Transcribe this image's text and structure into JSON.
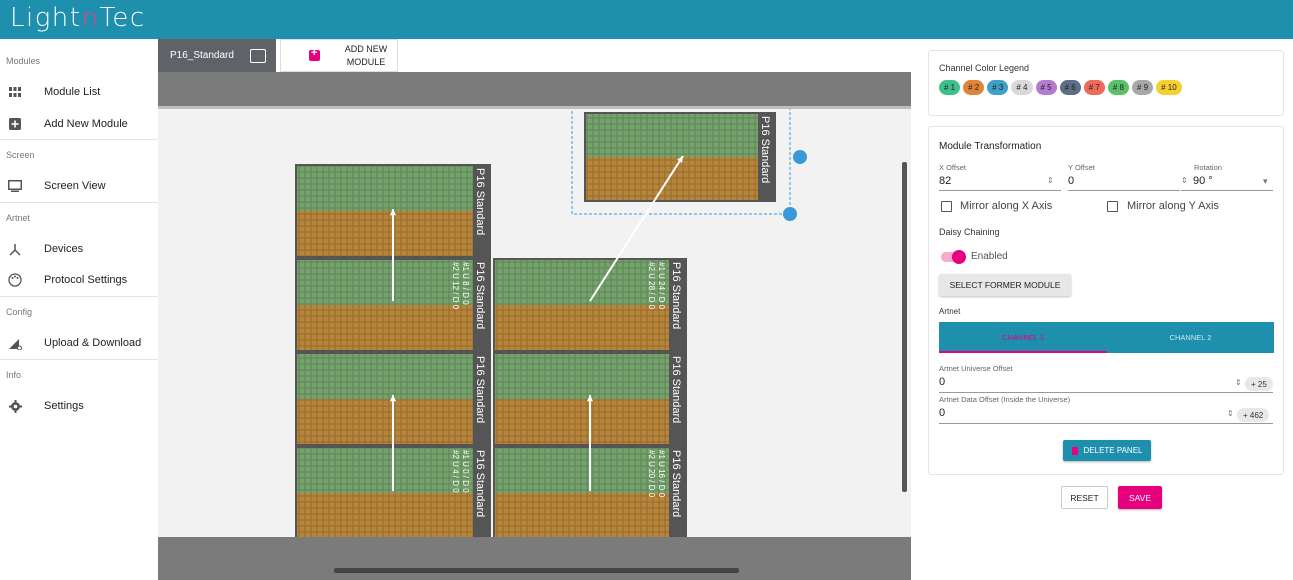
{
  "app": {
    "logo_pre": "Light",
    "logo_mark": "n",
    "logo_post": "Tec"
  },
  "sidebar": {
    "sections": [
      {
        "label": "Modules",
        "items": [
          {
            "label": "Module List",
            "icon": "grid-icon"
          },
          {
            "label": "Add New Module",
            "icon": "add-box-icon"
          }
        ]
      },
      {
        "label": "Screen",
        "items": [
          {
            "label": "Screen View",
            "icon": "monitor-icon"
          }
        ]
      },
      {
        "label": "Artnet",
        "items": [
          {
            "label": "Devices",
            "icon": "network-icon"
          },
          {
            "label": "Protocol Settings",
            "icon": "palette-icon"
          }
        ]
      },
      {
        "label": "Config",
        "items": [
          {
            "label": "Upload & Download",
            "icon": "signal-icon"
          }
        ]
      },
      {
        "label": "Info",
        "items": [
          {
            "label": "Settings",
            "icon": "gear-icon"
          }
        ]
      }
    ]
  },
  "tabs": {
    "active_label": "P16_Standard",
    "add_label": "ADD NEW MODULE"
  },
  "canvas": {
    "panel_name": "P16 Standard",
    "panels": [
      {
        "id": "p1",
        "label": "P16 Standard",
        "info": ""
      },
      {
        "id": "p2",
        "label": "P16 Standard",
        "info": "#1 U 8 / D 0\n#2 U 12 / D 0"
      },
      {
        "id": "p3",
        "label": "P16 Standard",
        "info": ""
      },
      {
        "id": "p4",
        "label": "P16 Standard",
        "info": "#1 U 0 / D 0\n#2 U 4 / D 0"
      },
      {
        "id": "p5",
        "label": "P16 Standard",
        "info": "#1 U 24 / D 0\n#2 U 28 / D 0"
      },
      {
        "id": "p6",
        "label": "P16 Standard",
        "info": ""
      },
      {
        "id": "p7",
        "label": "P16 Standard",
        "info": "#1 U 16 / D 0\n#2 U 20 / D 0"
      },
      {
        "id": "p8",
        "label": "P16 Standard",
        "info": ""
      }
    ]
  },
  "legend": {
    "title": "Channel Color Legend",
    "chips": [
      {
        "label": "# 1",
        "color": "#3fbf8a"
      },
      {
        "label": "# 2",
        "color": "#e0843a"
      },
      {
        "label": "# 3",
        "color": "#3ea0c8"
      },
      {
        "label": "# 4",
        "color": "#d9d9d9"
      },
      {
        "label": "# 5",
        "color": "#b57bd1"
      },
      {
        "label": "# 6",
        "color": "#5d6f86"
      },
      {
        "label": "# 7",
        "color": "#ee6a5a"
      },
      {
        "label": "# 8",
        "color": "#58c26a"
      },
      {
        "label": "# 9",
        "color": "#a8a8a8"
      },
      {
        "label": "# 10",
        "color": "#f5d030"
      }
    ]
  },
  "transform": {
    "title": "Module Transformation",
    "x_label": "X Offset",
    "x_value": "82",
    "y_label": "Y Offset",
    "y_value": "0",
    "rot_label": "Rotation",
    "rot_value": "90 °",
    "mirror_x": "Mirror along X Axis",
    "mirror_y": "Mirror along Y Axis",
    "daisy_title": "Daisy Chaining",
    "daisy_enabled": "Enabled",
    "select_former": "SELECT FORMER MODULE",
    "artnet_title": "Artnet",
    "channel1": "CHANNEL 1",
    "channel2": "CHANNEL 2",
    "universe_label": "Artnet Universe Offset",
    "universe_value": "0",
    "universe_badge": "+ 25",
    "data_label": "Artnet Data Offset (Inside the Universe)",
    "data_value": "0",
    "data_badge": "+ 462",
    "delete_label": "DELETE PANEL"
  },
  "actions": {
    "reset": "RESET",
    "save": "SAVE"
  },
  "colors": {
    "brand": "#1f8fae",
    "accent": "#e6007e"
  }
}
